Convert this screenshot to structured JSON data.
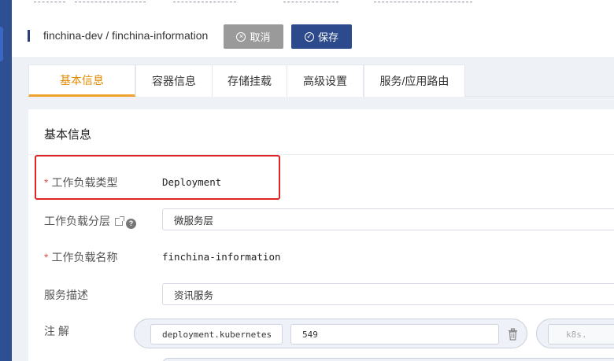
{
  "header": {
    "path": "finchina-dev / finchina-information",
    "cancel_label": "取消",
    "save_label": "保存"
  },
  "tabs": [
    {
      "label": "基本信息",
      "active": true
    },
    {
      "label": "容器信息",
      "active": false
    },
    {
      "label": "存储挂载",
      "active": false
    },
    {
      "label": "高级设置",
      "active": false
    },
    {
      "label": "服务/应用路由",
      "active": false
    }
  ],
  "panel": {
    "title": "基本信息",
    "workload_type_label": "工作负载类型",
    "workload_type_value": "Deployment",
    "workload_layer_label": "工作负载分层",
    "workload_layer_value": "微服务层",
    "workload_name_label": "工作负载名称",
    "workload_name_value": "finchina-information",
    "service_desc_label": "服务描述",
    "service_desc_value": "资讯服务",
    "annotations_label": "注 解",
    "annotations": [
      {
        "key": "deployment.kubernetes",
        "value": "549"
      },
      {
        "key": "k8s.",
        "value": ""
      }
    ]
  },
  "colors": {
    "primary": "#2c4a8c",
    "cancel": "#9a9a9a",
    "tab_active": "#f0a22e",
    "highlight": "#e02323",
    "required": "#e45656"
  }
}
